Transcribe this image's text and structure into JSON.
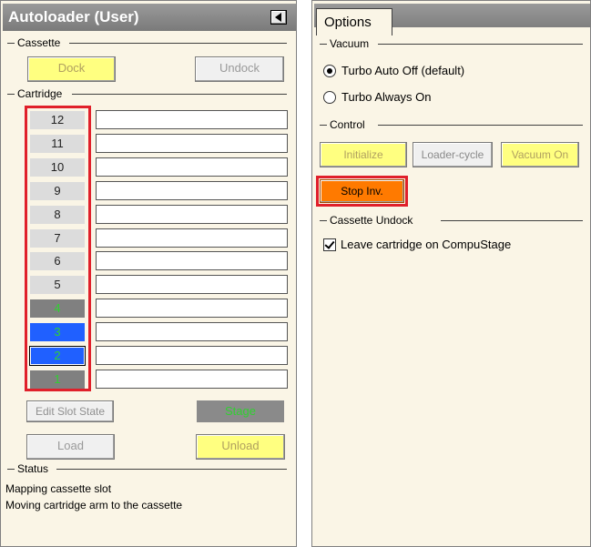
{
  "app": {
    "title": "Autoloader (User)"
  },
  "cassette": {
    "label": "Cassette",
    "dock_label": "Dock",
    "undock_label": "Undock"
  },
  "cartridge": {
    "label": "Cartridge",
    "slots": [
      {
        "label": "12",
        "state": "empty",
        "color": "#dcdcdc",
        "text_color": "#222222"
      },
      {
        "label": "11",
        "state": "empty",
        "color": "#dcdcdc",
        "text_color": "#222222"
      },
      {
        "label": "10",
        "state": "empty",
        "color": "#dcdcdc",
        "text_color": "#222222"
      },
      {
        "label": "9",
        "state": "empty",
        "color": "#dcdcdc",
        "text_color": "#222222"
      },
      {
        "label": "8",
        "state": "empty",
        "color": "#dcdcdc",
        "text_color": "#222222"
      },
      {
        "label": "7",
        "state": "empty",
        "color": "#dcdcdc",
        "text_color": "#222222"
      },
      {
        "label": "6",
        "state": "empty",
        "color": "#dcdcdc",
        "text_color": "#222222"
      },
      {
        "label": "5",
        "state": "empty",
        "color": "#dcdcdc",
        "text_color": "#222222"
      },
      {
        "label": "4",
        "state": "occupied",
        "color": "#808080",
        "text_color": "#30d030"
      },
      {
        "label": "3",
        "state": "loaded",
        "color": "#2060ff",
        "text_color": "#30d030"
      },
      {
        "label": "2",
        "state": "selected",
        "color": "#2060ff",
        "text_color": "#30d030"
      },
      {
        "label": "1",
        "state": "occupied",
        "color": "#808080",
        "text_color": "#30d030"
      }
    ]
  },
  "actions": {
    "edit_slot_state_label": "Edit Slot State",
    "stage_label": "Stage",
    "load_label": "Load",
    "unload_label": "Unload"
  },
  "status": {
    "label": "Status",
    "lines": [
      "Mapping cassette slot",
      "Moving cartridge arm to the cassette"
    ]
  },
  "options": {
    "tab_label": "Options",
    "vacuum": {
      "label": "Vacuum",
      "options": [
        {
          "label": "Turbo Auto Off (default)",
          "selected": true
        },
        {
          "label": "Turbo Always On",
          "selected": false
        }
      ]
    },
    "control": {
      "label": "Control",
      "initialize_label": "Initialize",
      "loader_cycle_label": "Loader-cycle",
      "vacuum_on_label": "Vacuum On",
      "stop_inv_label": "Stop Inv."
    },
    "cassette_undock": {
      "label": "Cassette Undock",
      "leave_cartridge_label": "Leave cartridge on CompuStage",
      "leave_cartridge_checked": true
    }
  },
  "colors": {
    "panel_bg": "#faf5e6",
    "yellow_button": "#ffff80",
    "stop_button": "#ff7a00",
    "highlight_red": "#e0202a",
    "stage_button": "#8a8a8a"
  }
}
